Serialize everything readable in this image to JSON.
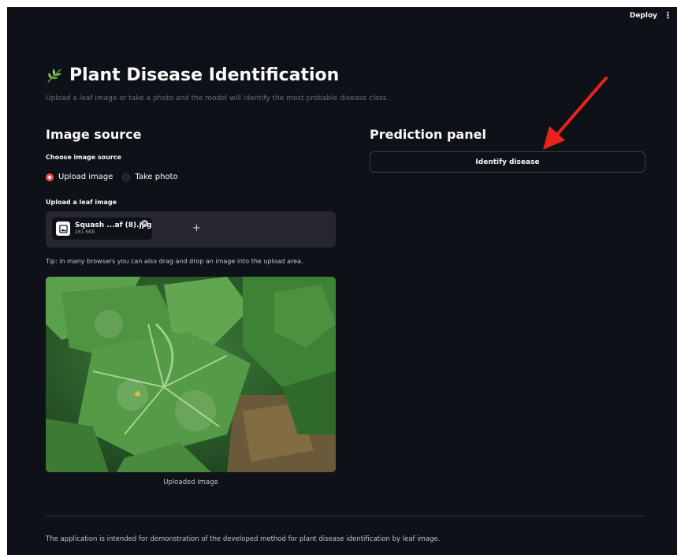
{
  "topbar": {
    "deploy_label": "Deploy",
    "menu_icon": "kebab-menu-icon"
  },
  "header": {
    "icon": "herb-leaf-icon",
    "title": "Plant Disease Identification",
    "subtitle": "Upload a leaf image or take a photo and the model will identify the most probable disease class."
  },
  "left": {
    "heading": "Image source",
    "source_label": "Choose image source",
    "source_options": [
      "Upload image",
      "Take photo"
    ],
    "selected_source": "Upload image",
    "upload_label": "Upload a leaf image",
    "file": {
      "name": "Squash ...af (8).jpg",
      "size": "261.6KB"
    },
    "tip": "Tip: in many browsers you can also drag and drop an image into the upload area.",
    "image_caption": "Uploaded image"
  },
  "right": {
    "heading": "Prediction panel",
    "identify_label": "Identify disease"
  },
  "footer": {
    "text": "The application is intended for demonstration of the developed method for plant disease identification by leaf image."
  },
  "colors": {
    "background": "#0e1117",
    "accent": "#ff4b4b",
    "surface": "#262730",
    "annotation_arrow": "#e8231b"
  }
}
